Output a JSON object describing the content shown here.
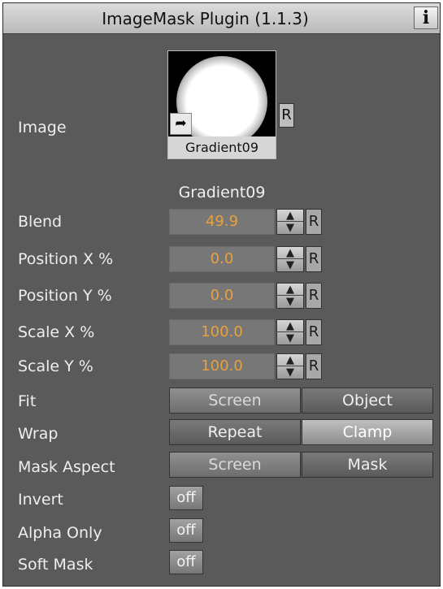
{
  "title": "ImageMask Plugin (1.1.3)",
  "info_label": "i",
  "image": {
    "label": "Image",
    "thumbnail_caption": "Gradient09",
    "name": "Gradient09",
    "reset_label": "R",
    "link_icon": "link-arrow-icon"
  },
  "numeric_fields": [
    {
      "label": "Blend",
      "value": "49.9",
      "reset": "R"
    },
    {
      "label": "Position X %",
      "value": "0.0",
      "reset": "R"
    },
    {
      "label": "Position Y %",
      "value": "0.0",
      "reset": "R"
    },
    {
      "label": "Scale X %",
      "value": "100.0",
      "reset": "R"
    },
    {
      "label": "Scale Y %",
      "value": "100.0",
      "reset": "R"
    }
  ],
  "fit": {
    "label": "Fit",
    "options": [
      "Screen",
      "Object"
    ],
    "selected": "Screen"
  },
  "wrap": {
    "label": "Wrap",
    "options": [
      "Repeat",
      "Clamp"
    ],
    "selected": "Repeat"
  },
  "mask_aspect": {
    "label": "Mask Aspect",
    "options": [
      "Screen",
      "Mask"
    ],
    "selected": "Screen"
  },
  "toggles": [
    {
      "label": "Invert",
      "value": "off"
    },
    {
      "label": "Alpha Only",
      "value": "off"
    },
    {
      "label": "Soft Mask",
      "value": "off"
    }
  ],
  "colors": {
    "panel_bg": "#5a5a5a",
    "value_text": "#e8a13c",
    "label_text": "#eeeeee"
  }
}
